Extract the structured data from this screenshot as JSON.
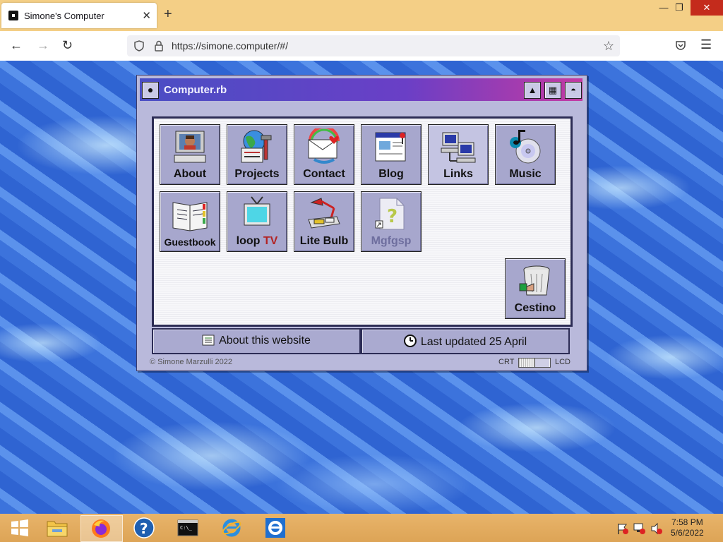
{
  "browser": {
    "tab_title": "Simone's Computer",
    "tab_close": "✕",
    "new_tab": "+",
    "url": "https://simone.computer/#/",
    "window_controls": {
      "minimize": "—",
      "maximize": "❐",
      "close": "✕"
    },
    "nav": {
      "back": "←",
      "forward": "→",
      "reload": "↻",
      "star": "☆",
      "menu": "☰"
    }
  },
  "window": {
    "title": "Computer.rb",
    "controls": [
      "▲",
      "▦",
      "◓"
    ],
    "icons": [
      {
        "id": "about",
        "label": "About"
      },
      {
        "id": "projects",
        "label": "Projects"
      },
      {
        "id": "contact",
        "label": "Contact"
      },
      {
        "id": "blog",
        "label": "Blog"
      },
      {
        "id": "links",
        "label": "Links"
      },
      {
        "id": "music",
        "label": "Music"
      },
      {
        "id": "guestbook",
        "label": "Guestbook"
      },
      {
        "id": "looptv",
        "label": "loop ",
        "label_accent": "TV"
      },
      {
        "id": "litebulb",
        "label": "Lite Bulb"
      },
      {
        "id": "mgfgsp",
        "label": "Mgfgsp"
      },
      {
        "id": "cestino",
        "label": "Cestino"
      }
    ],
    "buttons": {
      "about_site": "About this website",
      "last_updated": "Last updated 25 April"
    },
    "footer": {
      "copyright": "© Simone Marzulli 2022",
      "crt": "CRT",
      "lcd": "LCD",
      "display_mode": 0.5
    }
  },
  "taskbar": {
    "clock_time": "7:58 PM",
    "clock_date": "5/6/2022"
  }
}
